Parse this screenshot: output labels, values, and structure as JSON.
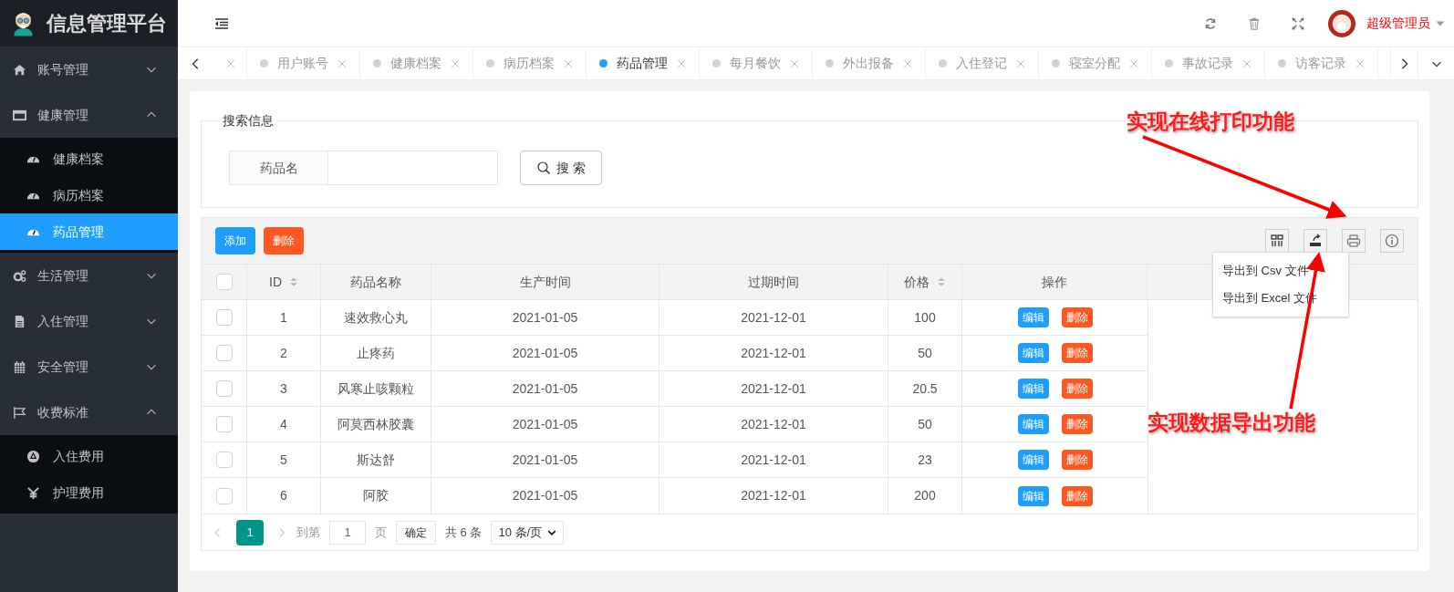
{
  "sidebar": {
    "title": "信息管理平台",
    "menu": [
      {
        "label": "账号管理",
        "expanded": false,
        "selected": false
      },
      {
        "label": "健康管理",
        "expanded": true,
        "selected": false,
        "children": [
          {
            "label": "健康档案",
            "selected": false
          },
          {
            "label": "病历档案",
            "selected": false
          },
          {
            "label": "药品管理",
            "selected": true
          }
        ]
      },
      {
        "label": "生活管理",
        "expanded": false,
        "selected": false
      },
      {
        "label": "入住管理",
        "expanded": false,
        "selected": false
      },
      {
        "label": "安全管理",
        "expanded": false,
        "selected": false
      },
      {
        "label": "收费标准",
        "expanded": true,
        "selected": false,
        "children": [
          {
            "label": "入住费用",
            "selected": false
          },
          {
            "label": "护理费用",
            "selected": false
          }
        ]
      }
    ]
  },
  "header": {
    "user_name": "超级管理员"
  },
  "tabs": [
    {
      "kind": "clipped"
    },
    {
      "kind": "tab",
      "label": "用户账号",
      "selected": false
    },
    {
      "kind": "tab",
      "label": "健康档案",
      "selected": false
    },
    {
      "kind": "tab",
      "label": "病历档案",
      "selected": false
    },
    {
      "kind": "tab",
      "label": "药品管理",
      "selected": true
    },
    {
      "kind": "tab",
      "label": "每月餐饮",
      "selected": false
    },
    {
      "kind": "tab",
      "label": "外出报备",
      "selected": false
    },
    {
      "kind": "tab",
      "label": "入住登记",
      "selected": false
    },
    {
      "kind": "tab",
      "label": "寝室分配",
      "selected": false
    },
    {
      "kind": "tab",
      "label": "事故记录",
      "selected": false
    },
    {
      "kind": "tab",
      "label": "访客记录",
      "selected": false
    }
  ],
  "search": {
    "legend": "搜索信息",
    "field_label": "药品名",
    "button": "搜 索"
  },
  "toolbar": {
    "buttons": [
      {
        "label": "添加",
        "kind": "primary"
      },
      {
        "label": "删除",
        "kind": "danger"
      }
    ]
  },
  "table": {
    "all_checked": false,
    "columns": [
      {
        "label": "ID",
        "sortable": true
      },
      {
        "label": "药品名称",
        "sortable": false
      },
      {
        "label": "生产时间",
        "sortable": false
      },
      {
        "label": "过期时间",
        "sortable": false
      },
      {
        "label": "价格",
        "sortable": true
      },
      {
        "label": "操作",
        "sortable": false
      }
    ],
    "rows": [
      {
        "checked": false,
        "cells": [
          "1",
          "速效救心丸",
          "2021-01-05",
          "2021-12-01",
          "100"
        ],
        "actions": [
          "编辑",
          "删除"
        ]
      },
      {
        "checked": false,
        "cells": [
          "2",
          "止疼药",
          "2021-01-05",
          "2021-12-01",
          "50"
        ],
        "actions": [
          "编辑",
          "删除"
        ]
      },
      {
        "checked": false,
        "cells": [
          "3",
          "风寒止咳颗粒",
          "2021-01-05",
          "2021-12-01",
          "20.5"
        ],
        "actions": [
          "编辑",
          "删除"
        ]
      },
      {
        "checked": false,
        "cells": [
          "4",
          "阿莫西林胶囊",
          "2021-01-05",
          "2021-12-01",
          "50"
        ],
        "actions": [
          "编辑",
          "删除"
        ]
      },
      {
        "checked": false,
        "cells": [
          "5",
          "斯达舒",
          "2021-01-05",
          "2021-12-01",
          "23"
        ],
        "actions": [
          "编辑",
          "删除"
        ]
      },
      {
        "checked": false,
        "cells": [
          "6",
          "阿胶",
          "2021-01-05",
          "2021-12-01",
          "200"
        ],
        "actions": [
          "编辑",
          "删除"
        ]
      }
    ]
  },
  "export_menu": [
    "导出到 Csv 文件",
    "导出到 Excel 文件"
  ],
  "pagination": {
    "current": "1",
    "goto_label": "到第",
    "page_input": "1",
    "page_unit": "页",
    "confirm": "确定",
    "total": "共 6 条",
    "page_size": "10 条/页"
  },
  "annotations": [
    "实现在线打印功能",
    "实现数据导出功能"
  ]
}
